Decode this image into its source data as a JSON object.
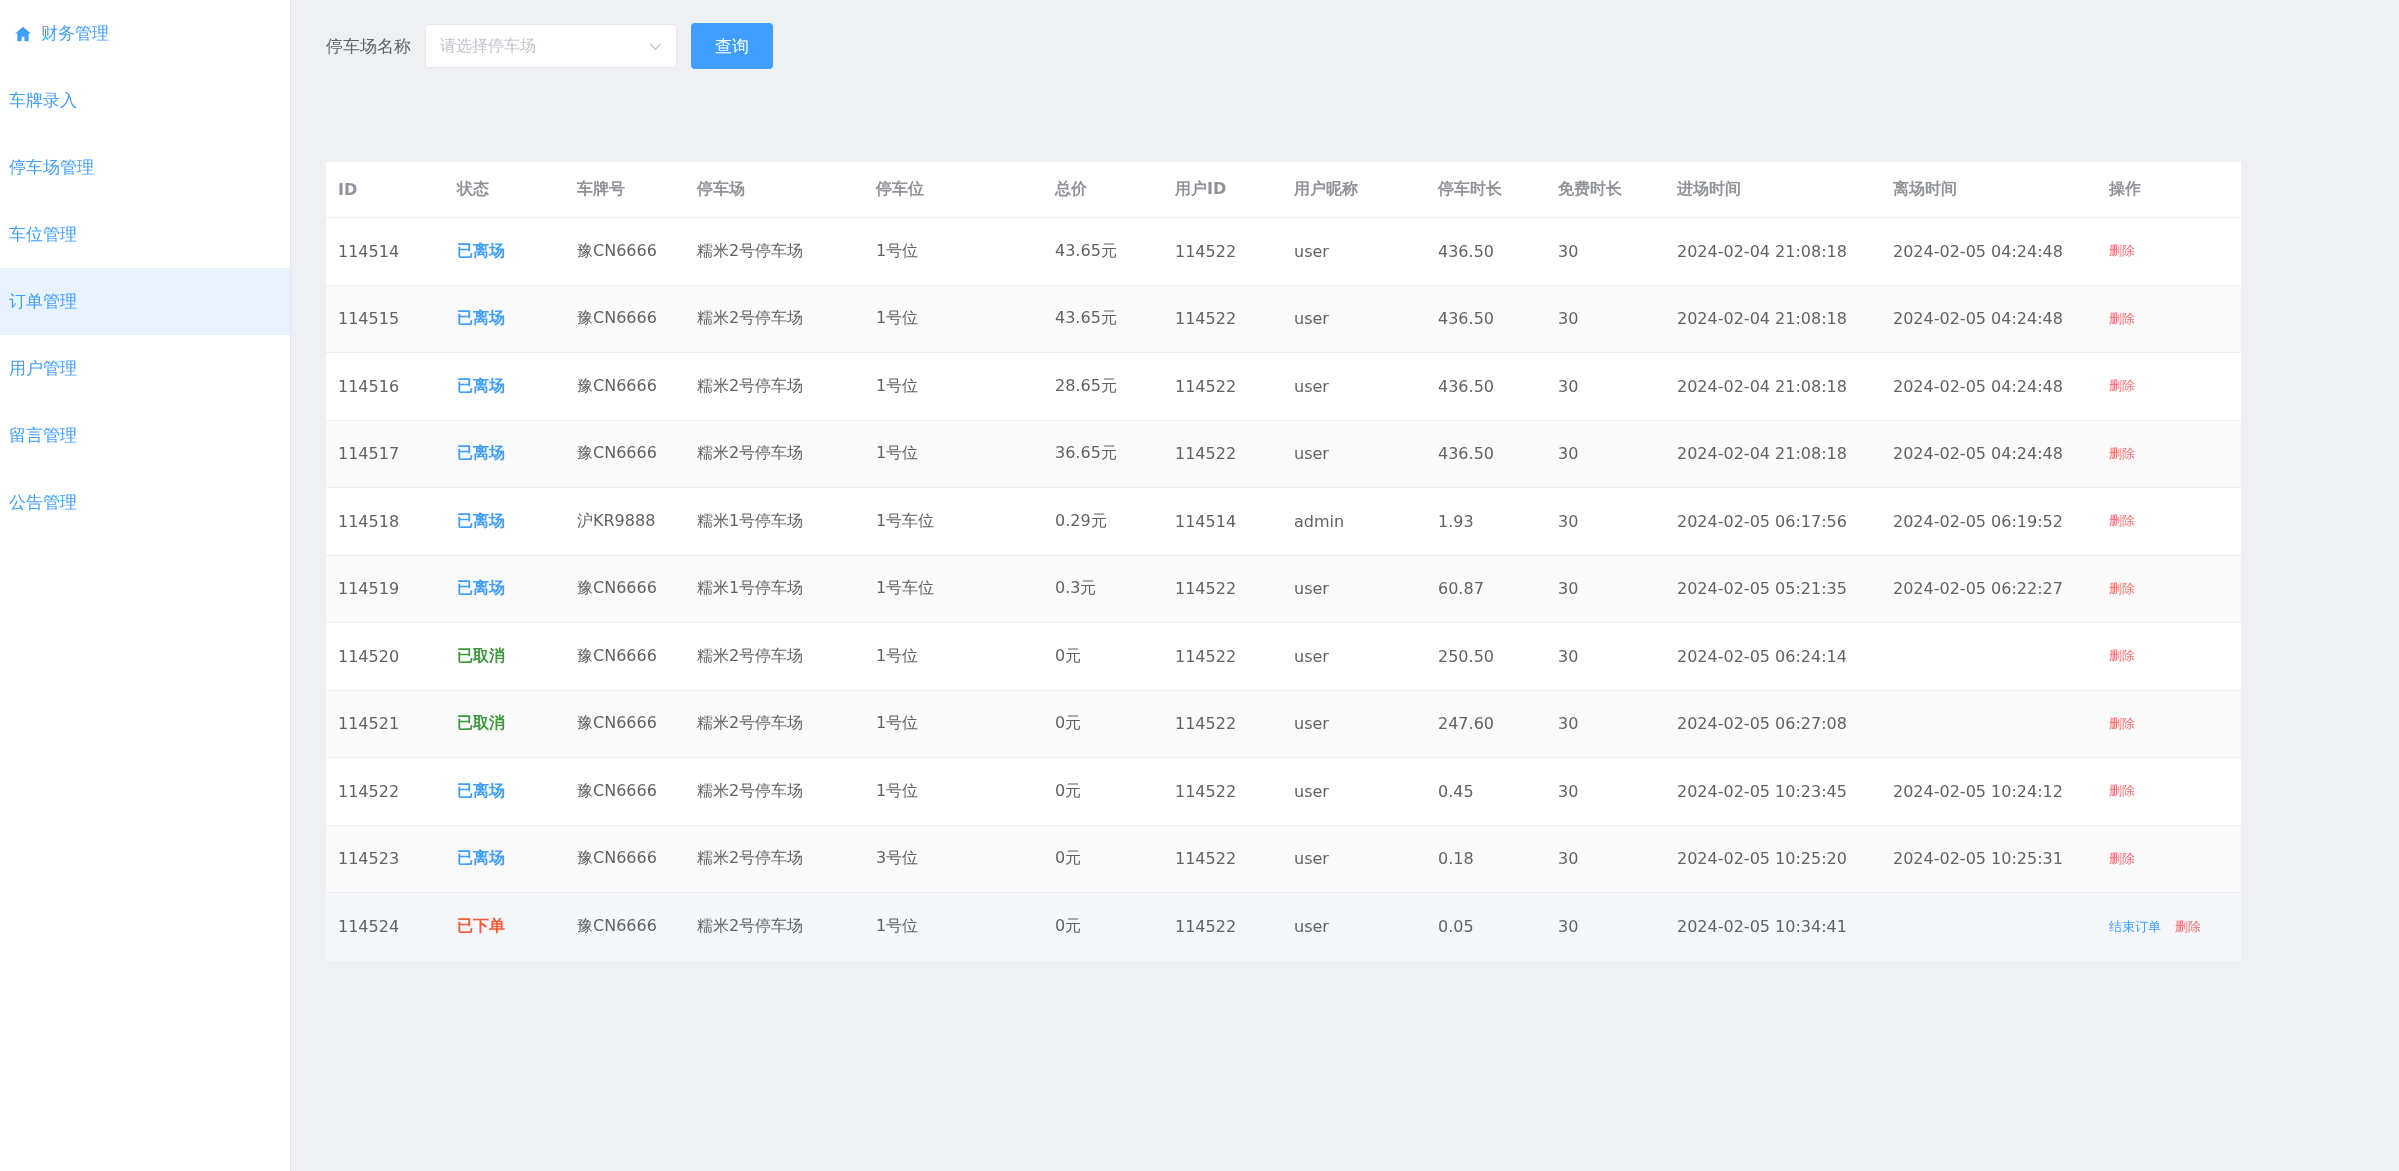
{
  "sidebar": {
    "items": [
      {
        "label": "财务管理",
        "kind": "home",
        "selected": false
      },
      {
        "label": "车牌录入",
        "kind": "plain",
        "selected": false
      },
      {
        "label": "停车场管理",
        "kind": "plain",
        "selected": false
      },
      {
        "label": "车位管理",
        "kind": "plain",
        "selected": false
      },
      {
        "label": "订单管理",
        "kind": "plain",
        "selected": true
      },
      {
        "label": "用户管理",
        "kind": "plain",
        "selected": false
      },
      {
        "label": "留言管理",
        "kind": "plain",
        "selected": false
      },
      {
        "label": "公告管理",
        "kind": "plain",
        "selected": false
      }
    ]
  },
  "filter": {
    "label": "停车场名称",
    "select": {
      "placeholder": "请选择停车场"
    },
    "button": "查询"
  },
  "table": {
    "columns": [
      "ID",
      "状态",
      "车牌号",
      "停车场",
      "停车位",
      "总价",
      "用户ID",
      "用户昵称",
      "停车时长",
      "免费时长",
      "进场时间",
      "离场时间",
      "操作"
    ],
    "rows": [
      {
        "hovered": false,
        "cells": [
          "114514",
          {
            "text": "已离场",
            "kind": "left"
          },
          "豫CN6666",
          "糯米2号停车场",
          "1号位",
          "43.65元",
          "114522",
          "user",
          "436.50",
          "30",
          "2024-02-04 21:08:18",
          "2024-02-05 04:24:48"
        ],
        "actions": [
          {
            "label": "删除",
            "kind": "delete"
          }
        ]
      },
      {
        "hovered": false,
        "cells": [
          "114515",
          {
            "text": "已离场",
            "kind": "left"
          },
          "豫CN6666",
          "糯米2号停车场",
          "1号位",
          "43.65元",
          "114522",
          "user",
          "436.50",
          "30",
          "2024-02-04 21:08:18",
          "2024-02-05 04:24:48"
        ],
        "actions": [
          {
            "label": "删除",
            "kind": "delete"
          }
        ]
      },
      {
        "hovered": false,
        "cells": [
          "114516",
          {
            "text": "已离场",
            "kind": "left"
          },
          "豫CN6666",
          "糯米2号停车场",
          "1号位",
          "28.65元",
          "114522",
          "user",
          "436.50",
          "30",
          "2024-02-04 21:08:18",
          "2024-02-05 04:24:48"
        ],
        "actions": [
          {
            "label": "删除",
            "kind": "delete"
          }
        ]
      },
      {
        "hovered": false,
        "cells": [
          "114517",
          {
            "text": "已离场",
            "kind": "left"
          },
          "豫CN6666",
          "糯米2号停车场",
          "1号位",
          "36.65元",
          "114522",
          "user",
          "436.50",
          "30",
          "2024-02-04 21:08:18",
          "2024-02-05 04:24:48"
        ],
        "actions": [
          {
            "label": "删除",
            "kind": "delete"
          }
        ]
      },
      {
        "hovered": false,
        "cells": [
          "114518",
          {
            "text": "已离场",
            "kind": "left"
          },
          "沪KR9888",
          "糯米1号停车场",
          "1号车位",
          "0.29元",
          "114514",
          "admin",
          "1.93",
          "30",
          "2024-02-05 06:17:56",
          "2024-02-05 06:19:52"
        ],
        "actions": [
          {
            "label": "删除",
            "kind": "delete"
          }
        ]
      },
      {
        "hovered": false,
        "cells": [
          "114519",
          {
            "text": "已离场",
            "kind": "left"
          },
          "豫CN6666",
          "糯米1号停车场",
          "1号车位",
          "0.3元",
          "114522",
          "user",
          "60.87",
          "30",
          "2024-02-05 05:21:35",
          "2024-02-05 06:22:27"
        ],
        "actions": [
          {
            "label": "删除",
            "kind": "delete"
          }
        ]
      },
      {
        "hovered": false,
        "cells": [
          "114520",
          {
            "text": "已取消",
            "kind": "cancelled"
          },
          "豫CN6666",
          "糯米2号停车场",
          "1号位",
          "0元",
          "114522",
          "user",
          "250.50",
          "30",
          "2024-02-05 06:24:14",
          ""
        ],
        "actions": [
          {
            "label": "删除",
            "kind": "delete"
          }
        ]
      },
      {
        "hovered": false,
        "cells": [
          "114521",
          {
            "text": "已取消",
            "kind": "cancelled"
          },
          "豫CN6666",
          "糯米2号停车场",
          "1号位",
          "0元",
          "114522",
          "user",
          "247.60",
          "30",
          "2024-02-05 06:27:08",
          ""
        ],
        "actions": [
          {
            "label": "删除",
            "kind": "delete"
          }
        ]
      },
      {
        "hovered": false,
        "cells": [
          "114522",
          {
            "text": "已离场",
            "kind": "left"
          },
          "豫CN6666",
          "糯米2号停车场",
          "1号位",
          "0元",
          "114522",
          "user",
          "0.45",
          "30",
          "2024-02-05 10:23:45",
          "2024-02-05 10:24:12"
        ],
        "actions": [
          {
            "label": "删除",
            "kind": "delete"
          }
        ]
      },
      {
        "hovered": false,
        "cells": [
          "114523",
          {
            "text": "已离场",
            "kind": "left"
          },
          "豫CN6666",
          "糯米2号停车场",
          "3号位",
          "0元",
          "114522",
          "user",
          "0.18",
          "30",
          "2024-02-05 10:25:20",
          "2024-02-05 10:25:31"
        ],
        "actions": [
          {
            "label": "删除",
            "kind": "delete"
          }
        ]
      },
      {
        "hovered": true,
        "cells": [
          "114524",
          {
            "text": "已下单",
            "kind": "ordered"
          },
          "豫CN6666",
          "糯米2号停车场",
          "1号位",
          "0元",
          "114522",
          "user",
          "0.05",
          "30",
          "2024-02-05 10:34:41",
          ""
        ],
        "actions": [
          {
            "label": "结束订单",
            "kind": "finish"
          },
          {
            "label": "删除",
            "kind": "delete"
          }
        ]
      }
    ]
  }
}
